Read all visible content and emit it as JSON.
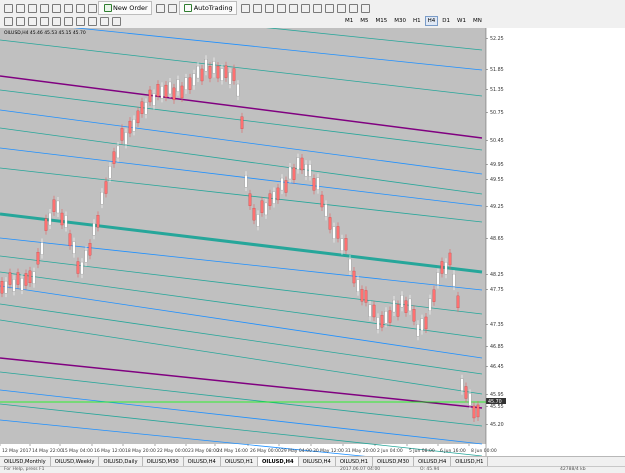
{
  "toolbar": {
    "new_order_label": "New Order",
    "autotrading_label": "AutoTrading",
    "timeframes": [
      "M1",
      "M5",
      "M15",
      "M30",
      "H1",
      "H4",
      "D1",
      "W1",
      "MN"
    ],
    "active_timeframe": "H4"
  },
  "chart": {
    "info": "OILUSD,H4  45.46 45.53 45.15 45.70",
    "price_labels": [
      "52.25",
      "51.85",
      "51.35",
      "50.75",
      "50.45",
      "49.95",
      "49.55",
      "49.25",
      "48.65",
      "48.25",
      "47.75",
      "47.35",
      "46.85",
      "46.45",
      "45.95",
      "45.55",
      "45.20"
    ],
    "current_price": "45.70",
    "current_price_line": "45.70",
    "date_labels": [
      "12 May 2017",
      "14 May 22:00",
      "15 May 04:00",
      "16 May 12:00",
      "18 May 20:00",
      "22 May 00:00",
      "23 May 08:00",
      "24 May 16:00",
      "26 May 00:00",
      "29 May 04:00",
      "30 May 12:00",
      "31 May 20:00",
      "2 Jun 04:00",
      "5 Jun 08:00",
      "6 Jun 16:00",
      "8 Jun 00:00"
    ],
    "colors": {
      "background": "#c0c0c0",
      "price_line": "#00ff00",
      "candle_up": "#ffffff",
      "candle_down": "#ff7070",
      "channel_teal": "#26a69a",
      "channel_blue": "#1e90ff",
      "channel_purple": "#800080"
    }
  },
  "tabs": [
    {
      "label": "OILUSD,Monthly"
    },
    {
      "label": "OILUSD,Weekly"
    },
    {
      "label": "OILUSD,Daily"
    },
    {
      "label": "OILUSD,M30"
    },
    {
      "label": "OILUSD,H4"
    },
    {
      "label": "OILUSD,H1"
    },
    {
      "label": "OILUSD,H4"
    },
    {
      "label": "OILUSD,H4"
    },
    {
      "label": "OILUSD,H1"
    },
    {
      "label": "OILUSD,M30"
    },
    {
      "label": "OILUSD,H4"
    },
    {
      "label": "OILUSD,H1"
    }
  ],
  "active_tab": 6,
  "status": {
    "left": "2017.06.07 04:00",
    "mid": "O: 45.94",
    "right": "42788/4 kb"
  }
}
